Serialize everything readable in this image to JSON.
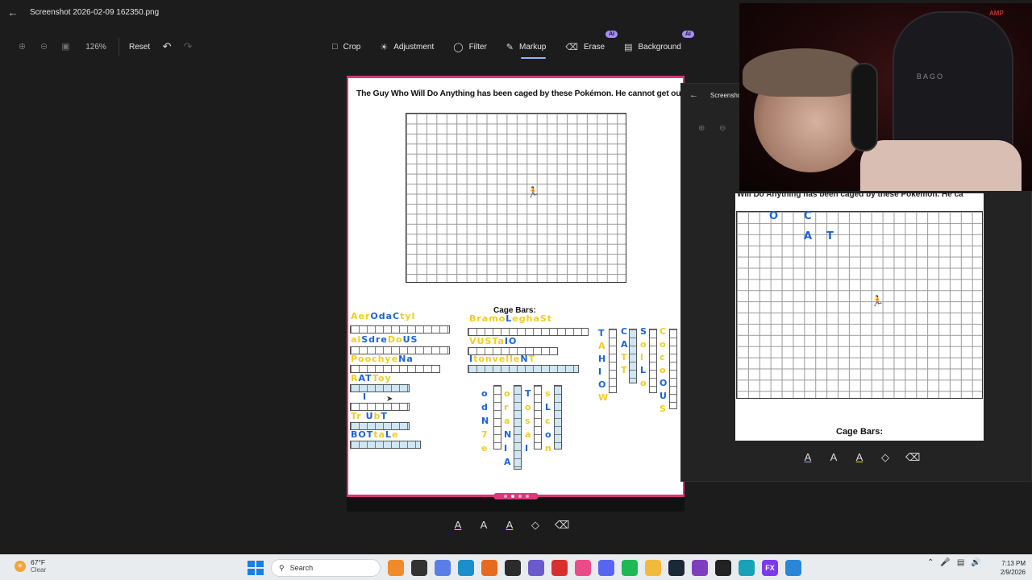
{
  "window": {
    "title": "Screenshot 2026-02-09 162350.png"
  },
  "toolbar": {
    "zoom_level": "126%",
    "reset_label": "Reset",
    "tools": [
      {
        "label": "Crop",
        "icon": "crop-icon",
        "ai": false
      },
      {
        "label": "Adjustment",
        "icon": "brightness-icon",
        "ai": false
      },
      {
        "label": "Filter",
        "icon": "filter-icon",
        "ai": false
      },
      {
        "label": "Markup",
        "icon": "pen-icon",
        "ai": false,
        "active": true
      },
      {
        "label": "Erase",
        "icon": "eraser-icon",
        "ai": true
      },
      {
        "label": "Background",
        "icon": "background-icon",
        "ai": true
      }
    ],
    "ai_badge": "AI"
  },
  "document": {
    "caption": "The Guy Who Will Do Anything has been caged by these Pokémon. He cannot get out.",
    "cage_title": "Cage Bars:",
    "left_words": [
      "AerOdaCtyl",
      "alSdreDoUS",
      "PoochyeNa",
      "RATToy",
      "I",
      "Tr UbT",
      "BOTtaLe"
    ],
    "middle_words": [
      "BramoLeghaSt",
      "VUSTaIO",
      "ItoNvelleNT"
    ],
    "vertical_left": [
      "o",
      "d",
      "N",
      "7",
      "e"
    ],
    "vertical_mid": [
      "T",
      "I",
      "N",
      "I",
      "A"
    ],
    "vertical_right": [
      "T",
      "A",
      "H",
      "I",
      "O",
      "W"
    ],
    "vertical_far": [
      "C",
      "S",
      "L",
      "O",
      "U"
    ],
    "page_count": 4,
    "current_page": 2
  },
  "markup_tools": [
    "ballpoint-pen-icon",
    "pencil-icon",
    "highlighter-icon",
    "eraser-icon",
    "clear-all-icon"
  ],
  "side_window": {
    "title": "Screensho",
    "caption": "Will Do Anything has been caged by these Pokémon. He ca",
    "letters": [
      "O",
      "C",
      "A",
      "T"
    ],
    "cage_title": "Cage Bars:"
  },
  "webcam": {
    "logo": "BAGO",
    "sign": "AMP"
  },
  "taskbar": {
    "weather_temp": "67°F",
    "weather_desc": "Clear",
    "search_label": "Search",
    "time": "7:13 PM",
    "date": "2/9/2026",
    "apps": [
      {
        "name": "pizza-app",
        "color": "#f08a2b"
      },
      {
        "name": "file-app",
        "color": "#333333"
      },
      {
        "name": "copilot-app",
        "color": "#5b7ee6"
      },
      {
        "name": "edge-app",
        "color": "#1a8fc9"
      },
      {
        "name": "firefox-app",
        "color": "#e76b1f"
      },
      {
        "name": "obs-app",
        "color": "#2b2b2b"
      },
      {
        "name": "chat-app",
        "color": "#6a5acd"
      },
      {
        "name": "red-app",
        "color": "#d8302f"
      },
      {
        "name": "music-app",
        "color": "#ea4c89"
      },
      {
        "name": "discord-app",
        "color": "#5865f2"
      },
      {
        "name": "spotify-app",
        "color": "#1db954"
      },
      {
        "name": "explorer-app",
        "color": "#f3b93c"
      },
      {
        "name": "steam-app",
        "color": "#1b2838"
      },
      {
        "name": "purple-app",
        "color": "#7e3fbf"
      },
      {
        "name": "dark-app",
        "color": "#222222"
      },
      {
        "name": "teal-app",
        "color": "#17a2b8"
      },
      {
        "name": "fx-app",
        "color": "#7c3aed"
      },
      {
        "name": "photos-app",
        "color": "#2a86d8"
      }
    ],
    "fx_label": "FX"
  }
}
